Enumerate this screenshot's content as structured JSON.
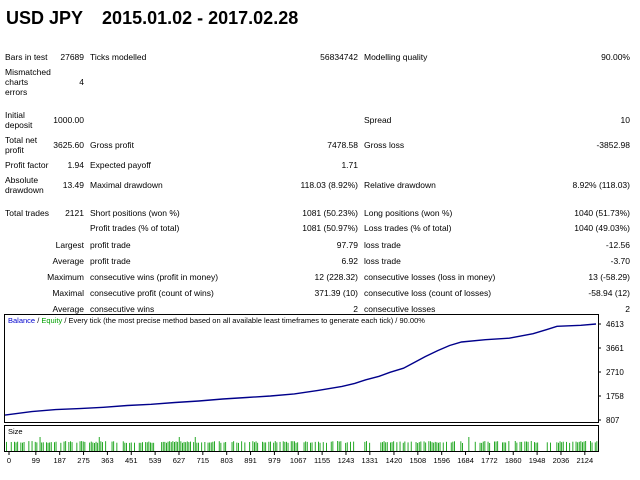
{
  "header": {
    "symbol": "USD JPY",
    "period": "2015.01.02 - 2017.02.28"
  },
  "summary": {
    "bars_in_test_label": "Bars in test",
    "bars_in_test": "27689",
    "ticks_modelled_label": "Ticks modelled",
    "ticks_modelled": "56834742",
    "modelling_quality_label": "Modelling quality",
    "modelling_quality": "90.00%",
    "mismatched_label": "Mismatched charts errors",
    "mismatched": "4",
    "initial_deposit_label": "Initial deposit",
    "initial_deposit": "1000.00",
    "spread_label": "Spread",
    "spread": "10",
    "total_net_profit_label": "Total net profit",
    "total_net_profit": "3625.60",
    "gross_profit_label": "Gross profit",
    "gross_profit": "7478.58",
    "gross_loss_label": "Gross loss",
    "gross_loss": "-3852.98",
    "profit_factor_label": "Profit factor",
    "profit_factor": "1.94",
    "expected_payoff_label": "Expected payoff",
    "expected_payoff": "1.71",
    "absolute_drawdown_label": "Absolute drawdown",
    "absolute_drawdown": "13.49",
    "maximal_drawdown_label": "Maximal drawdown",
    "maximal_drawdown": "118.03 (8.92%)",
    "relative_drawdown_label": "Relative drawdown",
    "relative_drawdown": "8.92% (118.03)",
    "total_trades_label": "Total trades",
    "total_trades": "2121",
    "short_positions_label": "Short positions (won %)",
    "short_positions": "1081 (50.23%)",
    "long_positions_label": "Long positions (won %)",
    "long_positions": "1040 (51.73%)",
    "profit_trades_label": "Profit trades (% of total)",
    "profit_trades": "1081 (50.97%)",
    "loss_trades_label": "Loss trades (% of total)",
    "loss_trades": "1040 (49.03%)",
    "largest_label": "Largest",
    "largest_profit_label": "profit trade",
    "largest_profit": "97.79",
    "largest_loss_label": "loss trade",
    "largest_loss": "-12.56",
    "average_label": "Average",
    "average_profit_label": "profit trade",
    "average_profit": "6.92",
    "average_loss_label": "loss trade",
    "average_loss": "-3.70",
    "maximum_label": "Maximum",
    "max_cons_wins_label": "consecutive wins (profit in money)",
    "max_cons_wins": "12 (228.32)",
    "max_cons_losses_label": "consecutive losses (loss in money)",
    "max_cons_losses": "13 (-58.29)",
    "maximal_label": "Maximal",
    "maximal_cons_profit_label": "consecutive profit (count of wins)",
    "maximal_cons_profit": "371.39 (10)",
    "maximal_cons_loss_label": "consecutive loss (count of losses)",
    "maximal_cons_loss": "-58.94 (12)",
    "average2_label": "Average",
    "avg_cons_wins_label": "consecutive wins",
    "avg_cons_wins": "2",
    "avg_cons_losses_label": "consecutive losses",
    "avg_cons_losses": "2"
  },
  "chart_data": {
    "type": "line",
    "legend": {
      "balance": "Balance",
      "separator": " / ",
      "equity": "Equity",
      "note": " / Every tick (the most precise method based on all available least timeframes to generate each tick) / 90.00%"
    },
    "colors": {
      "balance": "#00008b",
      "legend_balance": "#0000cd",
      "legend_equity": "#00a000",
      "size_bar": "#10a010",
      "axis": "#000000"
    },
    "x": [
      0,
      99,
      187,
      275,
      363,
      451,
      539,
      627,
      715,
      803,
      891,
      979,
      1067,
      1155,
      1243,
      1331,
      1420,
      1508,
      1596,
      1684,
      1772,
      1860,
      1948,
      2036,
      2124
    ],
    "y_ticks": [
      "4613",
      "3661",
      "2710",
      "1758",
      "807"
    ],
    "ylim": [
      807,
      4613
    ],
    "xlim": [
      0,
      2180
    ],
    "balance": [
      [
        0,
        1000
      ],
      [
        99,
        1140
      ],
      [
        187,
        1220
      ],
      [
        275,
        1260
      ],
      [
        363,
        1310
      ],
      [
        451,
        1380
      ],
      [
        539,
        1430
      ],
      [
        627,
        1500
      ],
      [
        715,
        1560
      ],
      [
        803,
        1640
      ],
      [
        891,
        1700
      ],
      [
        979,
        1760
      ],
      [
        1067,
        1840
      ],
      [
        1155,
        1980
      ],
      [
        1243,
        2140
      ],
      [
        1290,
        2260
      ],
      [
        1331,
        2400
      ],
      [
        1380,
        2540
      ],
      [
        1420,
        2700
      ],
      [
        1470,
        2860
      ],
      [
        1508,
        3080
      ],
      [
        1550,
        3320
      ],
      [
        1596,
        3560
      ],
      [
        1640,
        3760
      ],
      [
        1684,
        3900
      ],
      [
        1772,
        3990
      ],
      [
        1860,
        4050
      ],
      [
        1948,
        4230
      ],
      [
        2000,
        4400
      ],
      [
        2036,
        4520
      ],
      [
        2124,
        4560
      ],
      [
        2180,
        4613
      ]
    ],
    "size_label": "Size"
  }
}
